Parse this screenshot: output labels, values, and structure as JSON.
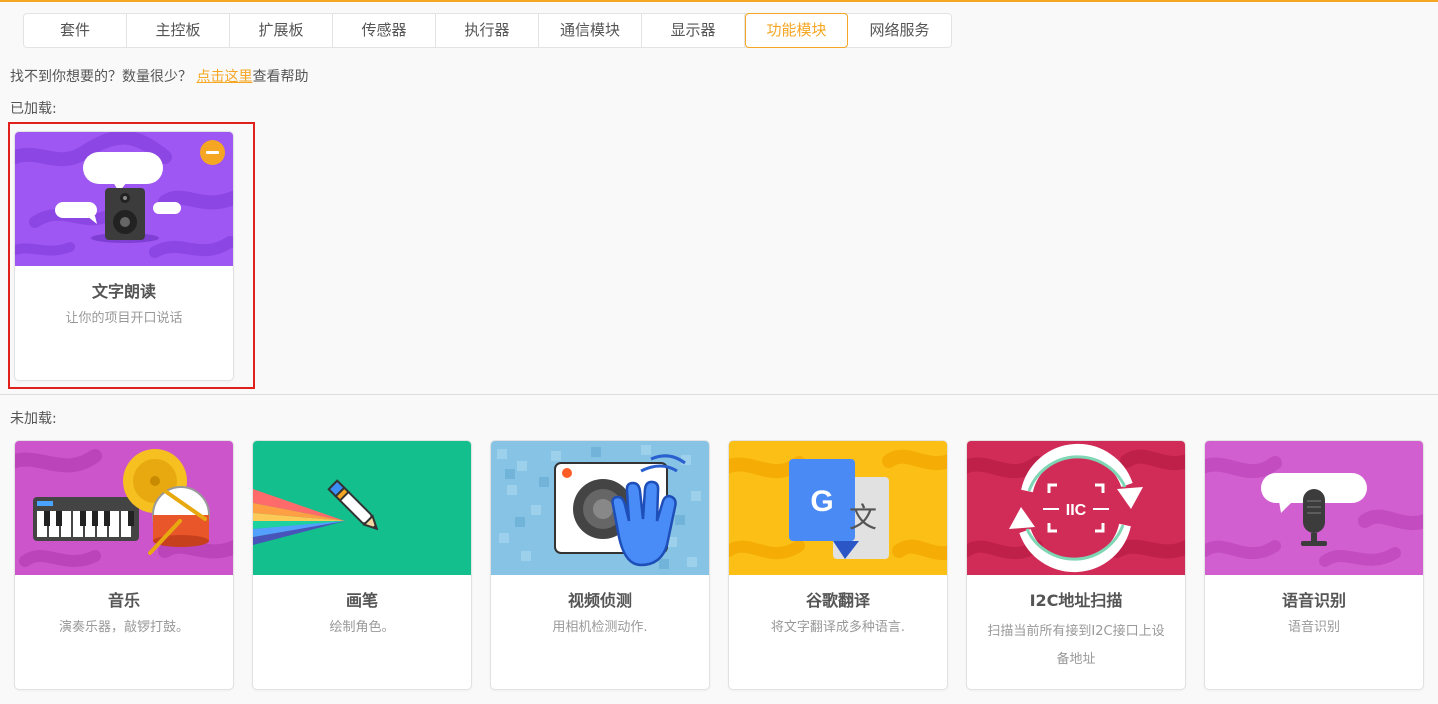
{
  "tabs": [
    "套件",
    "主控板",
    "扩展板",
    "传感器",
    "执行器",
    "通信模块",
    "显示器",
    "功能模块",
    "网络服务"
  ],
  "active_tab_index": 7,
  "help": {
    "prefix": "找不到你想要的？数量很少？",
    "link": "点击这里",
    "suffix": "查看帮助"
  },
  "loaded_label": "已加载:",
  "unloaded_label": "未加载:",
  "loaded": [
    {
      "title": "文字朗读",
      "desc": "让你的项目开口说话",
      "icon": "speaker-speech-icon"
    }
  ],
  "unloaded": [
    {
      "title": "音乐",
      "desc": "演奏乐器，敲锣打鼓。",
      "icon": "music-instruments-icon"
    },
    {
      "title": "画笔",
      "desc": "绘制角色。",
      "icon": "pen-rainbow-icon"
    },
    {
      "title": "视频侦测",
      "desc": "用相机检测动作.",
      "icon": "camera-hand-icon"
    },
    {
      "title": "谷歌翻译",
      "desc": "将文字翻译成多种语言.",
      "icon": "google-translate-icon"
    },
    {
      "title": "I2C地址扫描",
      "desc": "扫描当前所有接到I2C接口上设备地址",
      "icon": "i2c-scan-icon"
    },
    {
      "title": "语音识别",
      "desc": "语音识别",
      "icon": "microphone-speech-icon"
    }
  ],
  "i2c_label": "IIC",
  "google_letter": "G",
  "translate_glyph": "文",
  "colors": {
    "accent": "#f5a623",
    "selected_border": "#e0201b",
    "tts_bg": "#9e57f2",
    "music_bg": "#cc55cc",
    "pen_bg": "#13bf8c",
    "video_bg": "#86c3e4",
    "translate_bg": "#fcbf15",
    "i2c_bg": "#d12b57",
    "speech_bg": "#d15fcf"
  }
}
